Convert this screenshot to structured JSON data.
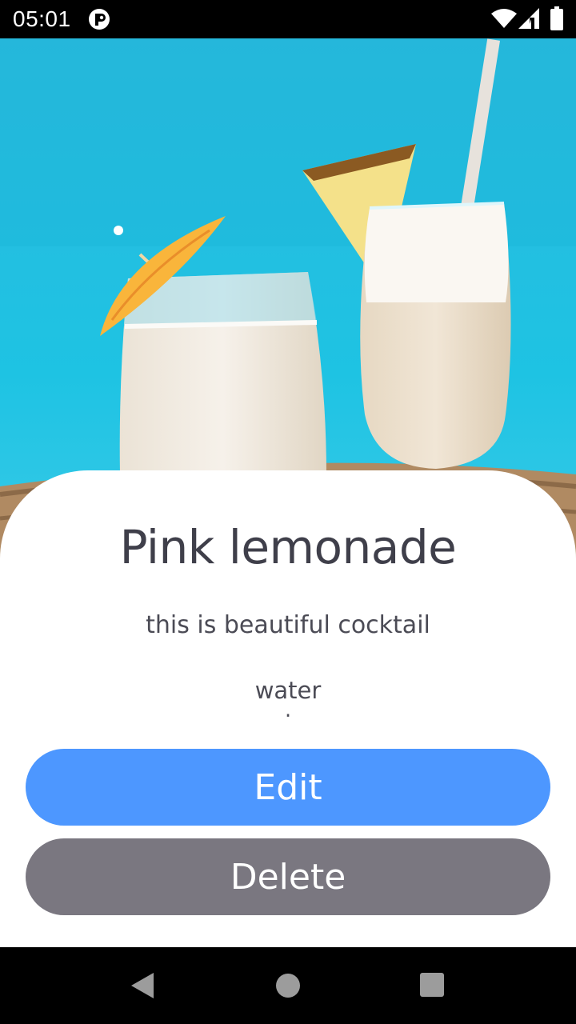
{
  "status_bar": {
    "time": "05:01",
    "icons": [
      "app-notification-icon",
      "wifi-icon",
      "signal-icon",
      "battery-icon"
    ]
  },
  "hero": {
    "image": "cocktail-photo",
    "description_icons": [
      "paper-umbrella",
      "pineapple-slice",
      "straw",
      "glass-left",
      "glass-right"
    ]
  },
  "drink": {
    "name": "Pink lemonade",
    "description": "this is beautiful cocktail",
    "ingredients": [
      "water",
      "i"
    ]
  },
  "actions": {
    "edit_label": "Edit",
    "delete_label": "Delete"
  },
  "navigation": {
    "icons": [
      "back-icon",
      "home-icon",
      "recents-icon"
    ]
  },
  "colors": {
    "primary": "#4d97ff",
    "secondary": "#7a7780",
    "sky": "#1ec3e3",
    "text": "#3f3f4a"
  }
}
